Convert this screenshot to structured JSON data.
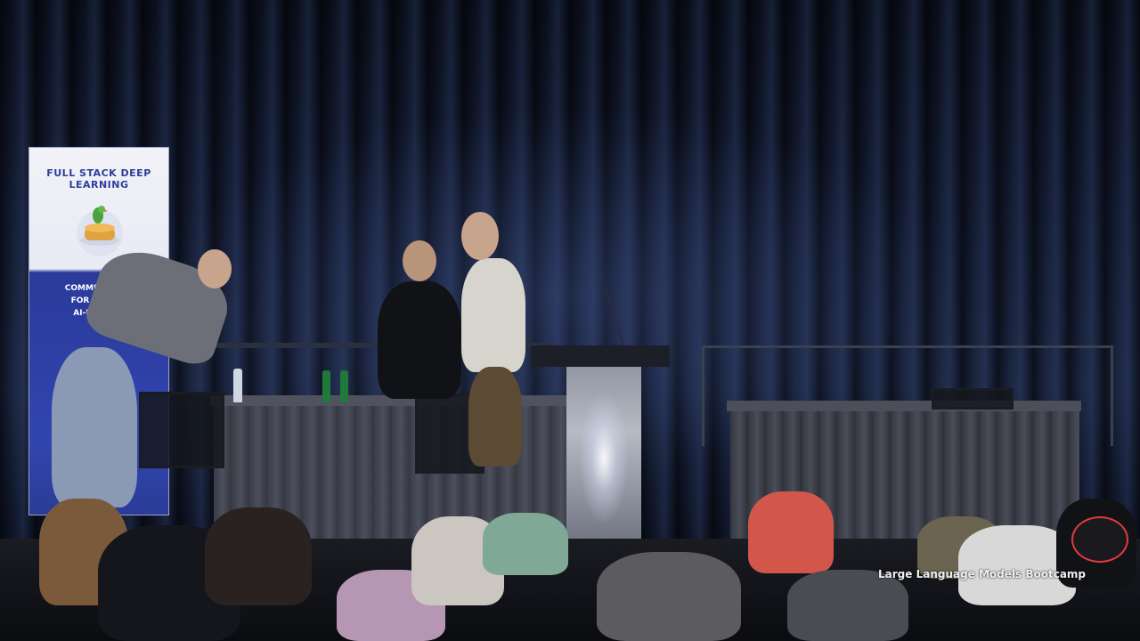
{
  "banner": {
    "title": "FULL STACK DEEP LEARNING",
    "line1": "COMMUNITY AI",
    "line2": "FOR PEOPLE",
    "line3": "AI-POWERE"
  },
  "caption": "Large Language Models Bootcamp",
  "colors": {
    "curtain": "#141c33",
    "banner_blue": "#3145b0",
    "banner_text": "#2d3d9a",
    "caption_text": "#f0f0f0"
  }
}
